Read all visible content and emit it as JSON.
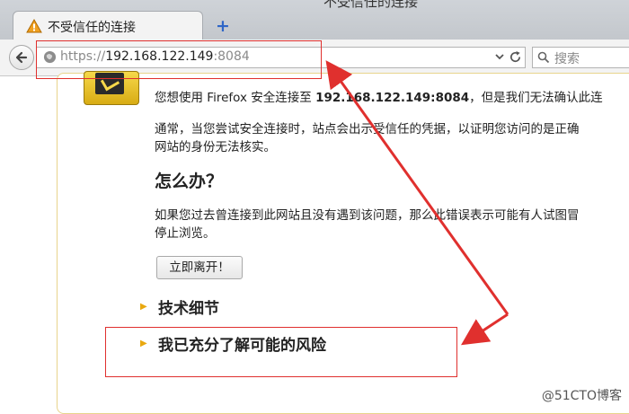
{
  "window": {
    "title_fragment": "不受信任的连接"
  },
  "tab": {
    "title": "不受信任的连接",
    "warn_icon": "warning-triangle-icon",
    "new_tab_icon": "plus-icon"
  },
  "navbar": {
    "url_proto": "https://",
    "url_host": "192.168.122.149",
    "url_port": ":8084",
    "search_placeholder": "搜索"
  },
  "page": {
    "intro_pre": "您想使用  Firefox 安全连接至  ",
    "intro_host": "192.168.122.149:8084",
    "intro_post": "，但是我们无法确认此连",
    "para1_line1": "通常，当您尝试安全连接时，站点会出示受信任的凭据，以证明您访问的是正确",
    "para1_line2": "网站的身份无法核实。",
    "heading": "怎么办？",
    "para2_line1": "如果您过去曾连接到此网站且没有遇到该问题，那么此错误表示可能有人试图冒",
    "para2_line2": "停止浏览。",
    "leave_button": "立即离开！",
    "section_tech": "技术细节",
    "section_risk": "我已充分了解可能的风险"
  },
  "watermark": "@51CTO博客",
  "colors": {
    "annotation": "#e0302e",
    "accent": "#2f66c7",
    "triangle": "#e9a80f"
  }
}
